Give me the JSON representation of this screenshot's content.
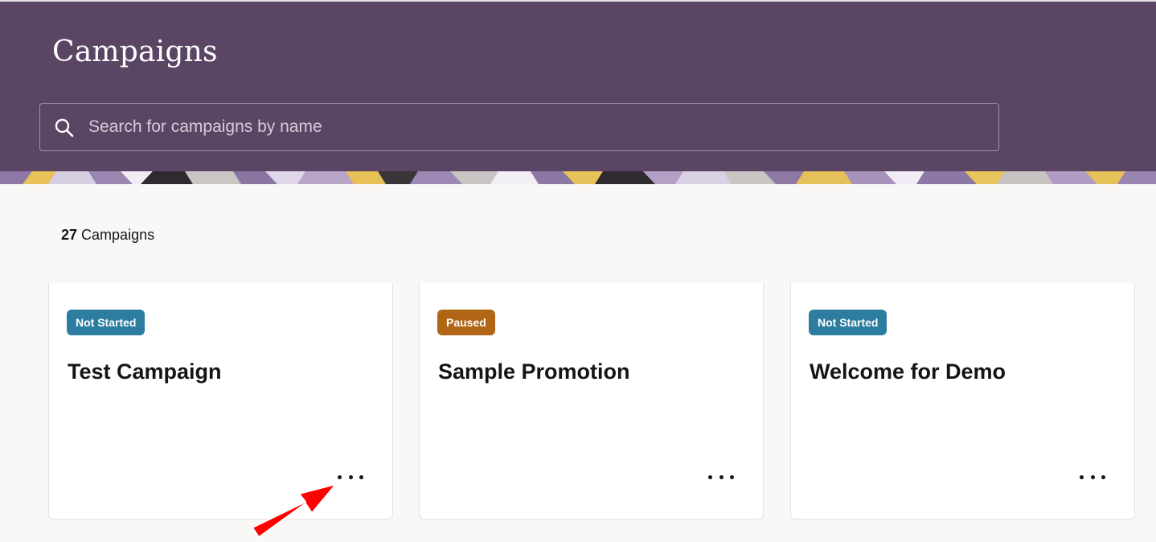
{
  "header": {
    "title": "Campaigns",
    "search_placeholder": "Search for campaigns by name",
    "search_value": ""
  },
  "summary": {
    "count": "27",
    "count_label": "Campaigns"
  },
  "cards": [
    {
      "status": "Not Started",
      "status_color": "#2c7d9f",
      "title": "Test Campaign",
      "menu_icon": "ellipsis-icon"
    },
    {
      "status": "Paused",
      "status_color": "#b06614",
      "title": "Sample Promotion",
      "menu_icon": "ellipsis-icon"
    },
    {
      "status": "Not Started",
      "status_color": "#2c7d9f",
      "title": "Welcome for Demo",
      "menu_icon": "ellipsis-icon"
    }
  ],
  "colors": {
    "header_bg": "#5a4664",
    "page_bg": "#f9f8f6",
    "annotation_arrow": "#ff0000"
  }
}
